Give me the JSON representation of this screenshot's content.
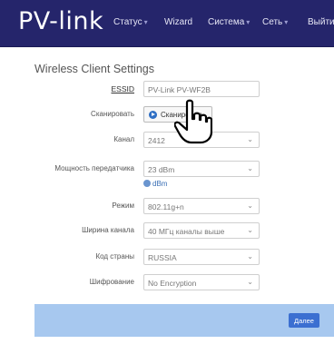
{
  "header": {
    "logo": "PV-link",
    "nav": [
      {
        "label": "Статус",
        "caret": "▾"
      },
      {
        "label": "Wizard",
        "caret": ""
      },
      {
        "label": "Система",
        "caret": "▾"
      },
      {
        "label": "Сеть",
        "caret": "▾"
      },
      {
        "label": "Выйти",
        "caret": ""
      }
    ]
  },
  "page": {
    "title": "Wireless Client Settings"
  },
  "form": {
    "essid": {
      "label": "ESSID",
      "value": "PV-Link PV-WF2B"
    },
    "scan": {
      "label": "Сканировать",
      "button": "Сканировать"
    },
    "channel": {
      "label": "Канал",
      "value": "2412"
    },
    "tx_power": {
      "label": "Мощность передатчика",
      "value": "23 dBm",
      "hint": "dBm"
    },
    "mode": {
      "label": "Режим",
      "value": "802.11g+n"
    },
    "width": {
      "label": "Ширина канала",
      "value": "40 МГц каналы выше"
    },
    "country": {
      "label": "Код страны",
      "value": "RUSSIA"
    },
    "encryption": {
      "label": "Шифрование",
      "value": "No Encryption"
    }
  },
  "footer": {
    "next_label": "Далее"
  },
  "icons": {
    "chevron": "chevron-down-icon",
    "scan": "play-circle-icon",
    "hint": "help-icon",
    "cursor": "hand-pointer-icon"
  },
  "colors": {
    "header_bg": "#25256b",
    "footer_bg": "#a7c8ef",
    "primary_button": "#3b6fd1"
  }
}
